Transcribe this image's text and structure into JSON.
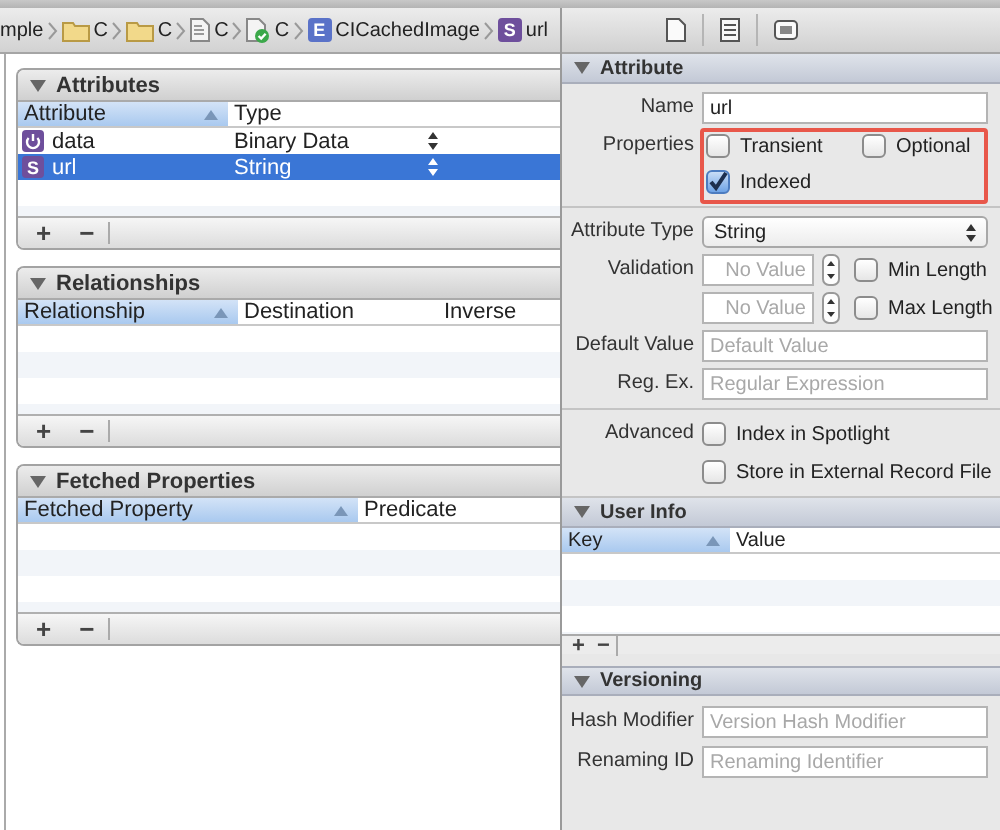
{
  "breadcrumb": [
    {
      "kind": "text",
      "label": "mple"
    },
    {
      "kind": "folder",
      "label": "C"
    },
    {
      "kind": "folder",
      "label": "C"
    },
    {
      "kind": "file",
      "label": "C"
    },
    {
      "kind": "checked_file",
      "label": "C"
    },
    {
      "kind": "badge",
      "badge": "E",
      "label": "CICachedImage"
    },
    {
      "kind": "badge",
      "badge": "S",
      "label": "url"
    }
  ],
  "entity_editor": {
    "sections": [
      {
        "title": "Attributes",
        "expanded": true,
        "columns": [
          {
            "label": "Attribute",
            "sorted": true
          },
          {
            "label": "Type",
            "sorted": false
          }
        ],
        "rows": [
          {
            "kind": "binary",
            "name": "data",
            "type": "Binary Data",
            "selected": false
          },
          {
            "kind": "string",
            "badge": "S",
            "name": "url",
            "type": "String",
            "selected": true
          }
        ],
        "buttons": [
          "+",
          "−"
        ]
      },
      {
        "title": "Relationships",
        "expanded": true,
        "columns": [
          {
            "label": "Relationship",
            "sorted": true
          },
          {
            "label": "Destination",
            "sorted": false
          },
          {
            "label": "Inverse",
            "sorted": false
          }
        ],
        "buttons": [
          "+",
          "−"
        ]
      },
      {
        "title": "Fetched Properties",
        "expanded": true,
        "columns": [
          {
            "label": "Fetched Property",
            "sorted": true
          },
          {
            "label": "Predicate",
            "sorted": false
          }
        ],
        "buttons": [
          "+",
          "−"
        ]
      }
    ]
  },
  "inspector": {
    "attribute": {
      "title": "Attribute",
      "expanded": true,
      "groups": [
        [
          {
            "kind": "text",
            "label": "Name",
            "value": "url"
          },
          {
            "kind": "check_grid",
            "label": "Properties",
            "highlighted": true,
            "options": [
              {
                "label": "Transient",
                "checked": false
              },
              {
                "label": "Optional",
                "checked": false
              },
              {
                "label": "Indexed",
                "checked": true
              }
            ]
          }
        ],
        [
          {
            "kind": "popup",
            "label": "Attribute Type",
            "value": "String"
          },
          {
            "kind": "stepper",
            "label": "Validation",
            "placeholder": "No Value",
            "option": {
              "label": "Min Length",
              "checked": false
            }
          },
          {
            "kind": "stepper",
            "placeholder": "No Value",
            "option": {
              "label": "Max Length",
              "checked": false
            }
          },
          {
            "kind": "text",
            "label": "Default Value",
            "placeholder": "Default Value"
          },
          {
            "kind": "text",
            "label": "Reg. Ex.",
            "placeholder": "Regular Expression"
          }
        ],
        [
          {
            "kind": "check_list",
            "label": "Advanced",
            "options": [
              {
                "label": "Index in Spotlight",
                "checked": false
              },
              {
                "label": "Store in External Record File",
                "checked": false
              }
            ]
          }
        ]
      ]
    },
    "user_info": {
      "title": "User Info",
      "expanded": true,
      "columns": [
        {
          "label": "Key",
          "sorted": true
        },
        {
          "label": "Value",
          "sorted": false
        }
      ],
      "buttons": [
        "+",
        "−"
      ]
    },
    "versioning": {
      "title": "Versioning",
      "expanded": true,
      "fields": [
        {
          "label": "Hash Modifier",
          "placeholder": "Version Hash Modifier"
        },
        {
          "label": "Renaming ID",
          "placeholder": "Renaming Identifier"
        }
      ]
    }
  }
}
